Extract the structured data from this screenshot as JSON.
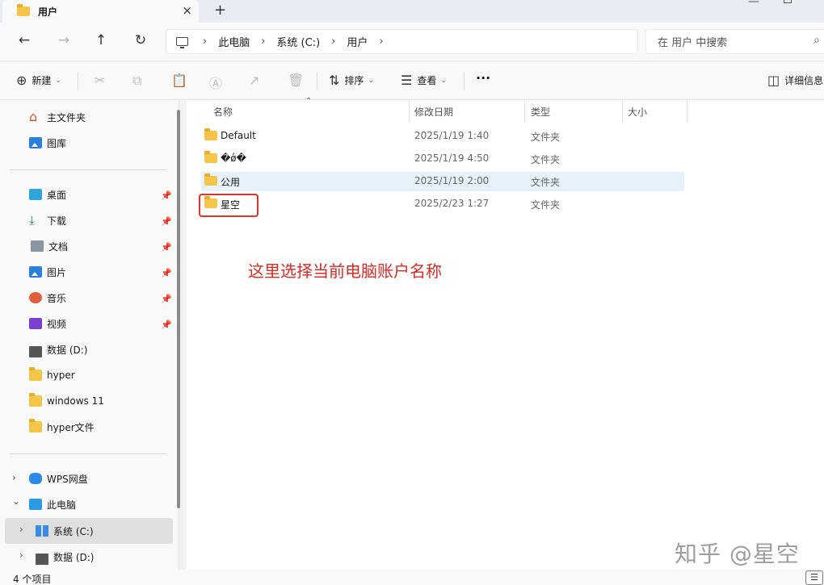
{
  "tab": {
    "title": "用户",
    "close_icon": "×",
    "add_icon": "+"
  },
  "window_controls": {
    "minimize": "—"
  },
  "nav": {
    "back_icon": "←",
    "forward_icon": "→",
    "up_icon": "↑",
    "refresh_icon": "↻",
    "breadcrumb": [
      "此电脑",
      "系统 (C:)",
      "用户"
    ],
    "separator": "›",
    "search_placeholder": "在 用户 中搜索",
    "search_icon": "⌕"
  },
  "commands": {
    "new_label": "新建",
    "sort_label": "排序",
    "view_label": "查看",
    "more_label": "···",
    "details_label": "详细信息",
    "icons": {
      "new": "⊕",
      "cut": "✂",
      "copy": "⧉",
      "paste": "📋",
      "rename": "Ⓐ",
      "share": "↗",
      "delete": "🗑",
      "sort": "⇅",
      "view": "☰",
      "details": "◫",
      "chevron": "⌄"
    }
  },
  "sidebar": {
    "quick": [
      {
        "label": "主文件夹",
        "icon": "home-icon"
      },
      {
        "label": "图库",
        "icon": "gallery-icon"
      }
    ],
    "pinned": [
      {
        "label": "桌面",
        "icon": "desktop-icon"
      },
      {
        "label": "下载",
        "icon": "download-icon"
      },
      {
        "label": "文档",
        "icon": "document-icon"
      },
      {
        "label": "图片",
        "icon": "pictures-icon"
      },
      {
        "label": "音乐",
        "icon": "music-icon"
      },
      {
        "label": "视频",
        "icon": "video-icon"
      },
      {
        "label": "数据 (D:)",
        "icon": "drive-icon"
      },
      {
        "label": "hyper",
        "icon": "folder-icon"
      },
      {
        "label": "windows 11",
        "icon": "folder-icon"
      },
      {
        "label": "hyper文件",
        "icon": "folder-icon"
      }
    ],
    "tree": [
      {
        "label": "WPS网盘",
        "icon": "cloud-icon"
      },
      {
        "label": "此电脑",
        "icon": "pc-icon"
      },
      {
        "label": "系统 (C:)",
        "icon": "windows-drive-icon"
      },
      {
        "label": "数据 (D:)",
        "icon": "drive-icon"
      }
    ],
    "pin_icon": "📌",
    "chevron_right": "›",
    "chevron_down": "⌄",
    "download_glyph": "⤓",
    "home_glyph": "⌂"
  },
  "columns": {
    "name": "名称",
    "modified": "修改日期",
    "type": "类型",
    "size": "大小",
    "sort_icon": "⌃"
  },
  "files": [
    {
      "name": "Default",
      "modified": "2025/1/19 1:40",
      "type": "文件夹"
    },
    {
      "name": "�ǿ�",
      "modified": "2025/1/19 4:50",
      "type": "文件夹"
    },
    {
      "name": "公用",
      "modified": "2025/1/19 2:00",
      "type": "文件夹"
    },
    {
      "name": "星空",
      "modified": "2025/2/23 1:27",
      "type": "文件夹"
    }
  ],
  "annotation": "这里选择当前电脑账户名称",
  "watermark": "知乎 @星空",
  "status": {
    "item_count": "4 个项目",
    "view_icon": "☰"
  },
  "colors": {
    "selection": "#e5f1fb",
    "annotation": "#d42b24",
    "folder": "#f5c54a"
  }
}
